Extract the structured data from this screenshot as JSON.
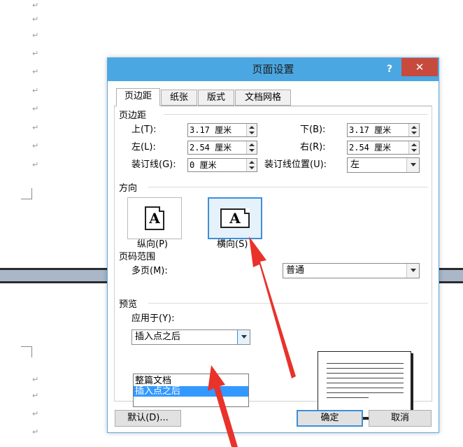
{
  "dialog": {
    "title": "页面设置",
    "help": "?",
    "close": "✕"
  },
  "tabs": [
    {
      "label": "页边距"
    },
    {
      "label": "纸张"
    },
    {
      "label": "版式"
    },
    {
      "label": "文档网格"
    }
  ],
  "margins": {
    "group": "页边距",
    "top_label": "上(T):",
    "top_value": "3.17 厘米",
    "bottom_label": "下(B):",
    "bottom_value": "3.17 厘米",
    "left_label": "左(L):",
    "left_value": "2.54 厘米",
    "right_label": "右(R):",
    "right_value": "2.54 厘米",
    "gutter_label": "装订线(G):",
    "gutter_value": "0 厘米",
    "gutter_pos_label": "装订线位置(U):",
    "gutter_pos_value": "左"
  },
  "orientation": {
    "group": "方向",
    "portrait_label": "纵向(P)",
    "landscape_label": "横向(S)",
    "glyph": "A",
    "selected": "landscape"
  },
  "pages": {
    "group": "页码范围",
    "multiple_label": "多页(M):",
    "multiple_value": "普通"
  },
  "preview": {
    "group": "预览",
    "apply_label": "应用于(Y):",
    "apply_value": "插入点之后",
    "options": [
      "整篇文档",
      "插入点之后"
    ],
    "selected_option": "插入点之后"
  },
  "buttons": {
    "default": "默认(D)...",
    "ok": "确定",
    "cancel": "取消"
  },
  "document": {
    "para_mark": "↵"
  },
  "colors": {
    "titlebar": "#4ba7e2",
    "close": "#c74a3c",
    "selection": "#3399ff",
    "arrow": "#e8322a"
  }
}
